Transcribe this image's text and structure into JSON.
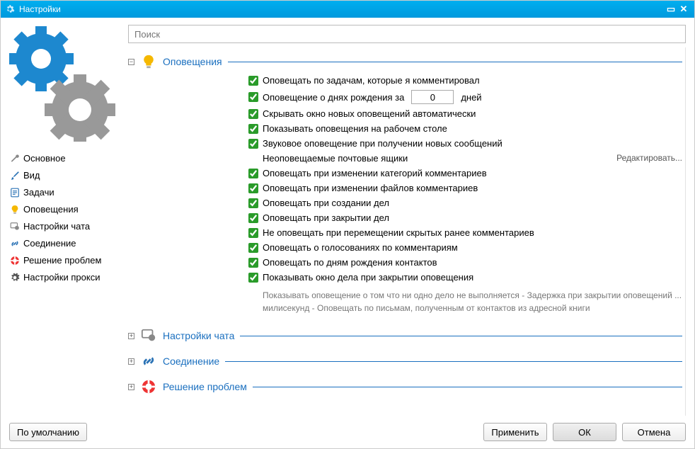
{
  "window": {
    "title": "Настройки"
  },
  "search": {
    "placeholder": "Поиск"
  },
  "sidebar": {
    "items": [
      {
        "icon": "wrench-icon",
        "label": "Основное"
      },
      {
        "icon": "brush-icon",
        "label": "Вид"
      },
      {
        "icon": "tasks-icon",
        "label": "Задачи"
      },
      {
        "icon": "bulb-icon",
        "label": "Оповещения"
      },
      {
        "icon": "chat-icon",
        "label": "Настройки чата"
      },
      {
        "icon": "link-icon",
        "label": "Соединение"
      },
      {
        "icon": "lifebuoy-icon",
        "label": "Решение проблем"
      },
      {
        "icon": "gear-icon",
        "label": "Настройки прокси"
      }
    ]
  },
  "sections": {
    "notifications": {
      "title": "Оповещения",
      "options": [
        {
          "checked": true,
          "label": "Оповещать по задачам, которые я комментировал"
        },
        {
          "checked": true,
          "label_pre": "Оповещение о днях рождения за",
          "value": "0",
          "label_post": "дней"
        },
        {
          "checked": true,
          "label": "Скрывать окно новых оповещений автоматически"
        },
        {
          "checked": true,
          "label": "Показывать оповещения на рабочем столе"
        },
        {
          "checked": true,
          "label": "Звуковое оповещение при получении новых сообщений"
        }
      ],
      "unmonitored": {
        "label": "Неоповещаемые почтовые ящики",
        "edit": "Редактировать..."
      },
      "options2": [
        {
          "checked": true,
          "label": "Оповещать при изменении категорий комментариев"
        },
        {
          "checked": true,
          "label": "Оповещать при изменении файлов комментариев"
        },
        {
          "checked": true,
          "label": "Оповещать при создании дел"
        },
        {
          "checked": true,
          "label": "Оповещать при закрытии дел"
        },
        {
          "checked": true,
          "label": "Не оповещать при перемещении скрытых ранее комментариев"
        },
        {
          "checked": true,
          "label": "Оповещать о голосованиях по комментариям"
        },
        {
          "checked": true,
          "label": "Оповещать по дням рождения контактов"
        },
        {
          "checked": true,
          "label": "Показывать окно дела при закрытии оповещения"
        }
      ],
      "footnote": "Показывать оповещение о том что ни одно дело не выполняется -  Задержка при закрытии оповещений ... милисекунд -  Оповещать по письмам, полученным от контактов из адресной книги"
    },
    "chat": {
      "title": "Настройки чата"
    },
    "connection": {
      "title": "Соединение"
    },
    "troubleshoot": {
      "title": "Решение проблем"
    }
  },
  "footer": {
    "defaults": "По умолчанию",
    "apply": "Применить",
    "ok": "ОК",
    "cancel": "Отмена"
  }
}
